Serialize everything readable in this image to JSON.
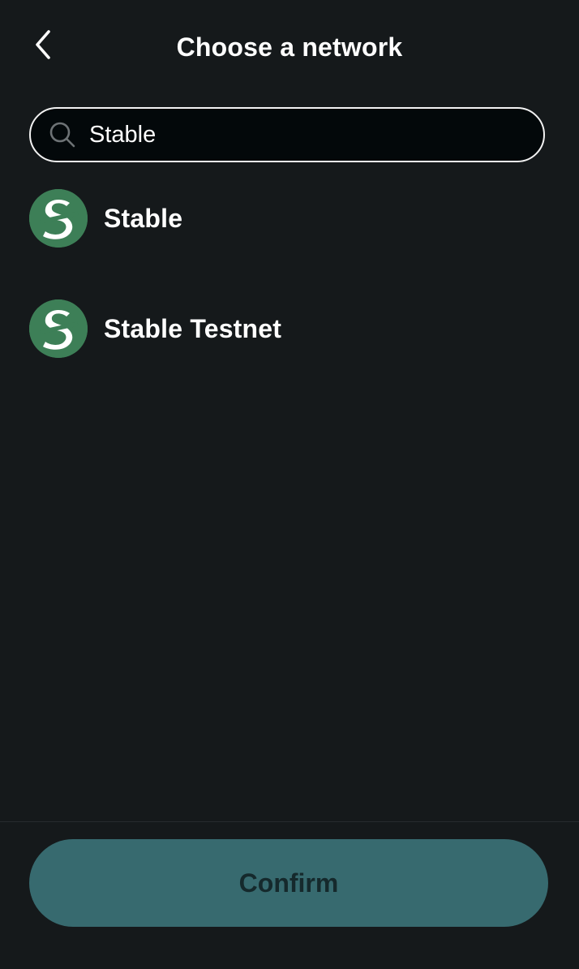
{
  "header": {
    "title": "Choose a network",
    "back_icon": "chevron-left-icon"
  },
  "search": {
    "value": "Stable",
    "icon": "search-icon"
  },
  "networks": [
    {
      "name": "Stable",
      "logo": "stable-logo-icon",
      "logo_color": "#3d7f57"
    },
    {
      "name": "Stable Testnet",
      "logo": "stable-logo-icon",
      "logo_color": "#3d7f57"
    }
  ],
  "footer": {
    "confirm_label": "Confirm",
    "confirm_color": "#376a6f"
  },
  "colors": {
    "background": "#15191b",
    "search_background": "#03080a",
    "search_border": "#f2f2f2"
  }
}
